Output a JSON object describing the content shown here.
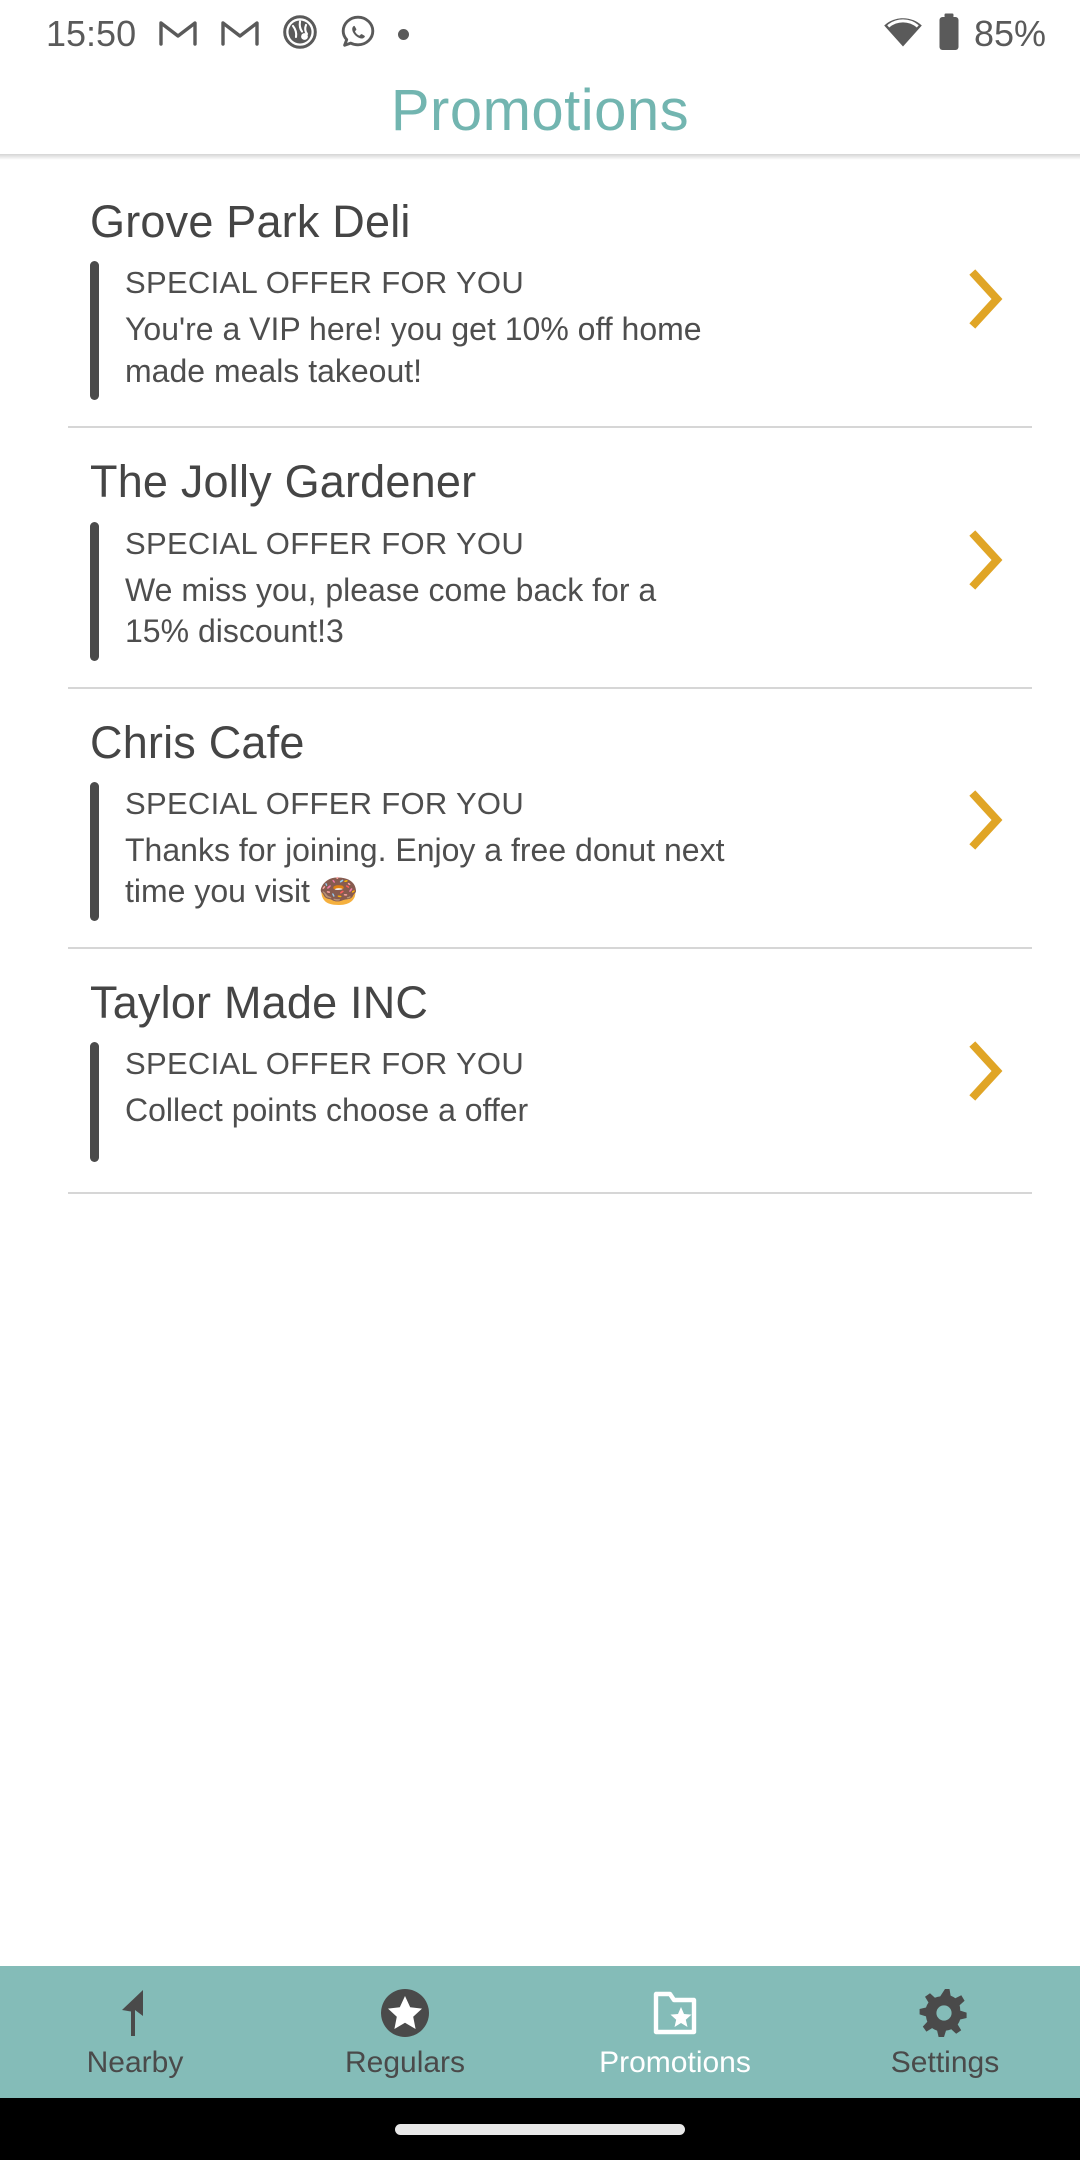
{
  "status_bar": {
    "time": "15:50",
    "battery_percent": "85%",
    "left_icons": [
      "gmail-icon",
      "gmail-icon",
      "browser-globe-icon",
      "whatsapp-icon",
      "dot-indicator-icon"
    ],
    "right_icons": [
      "wifi-icon",
      "battery-icon"
    ]
  },
  "app_bar": {
    "title": "Promotions",
    "title_color": "#72b5b0"
  },
  "colors": {
    "accent_teal": "#72b5b0",
    "nav_background": "#84bcb8",
    "chevron_orange": "#e0a526",
    "text_dark": "#454545",
    "divider": "#d6d6d6"
  },
  "promotions": [
    {
      "merchant": "Grove Park Deli",
      "offer_heading": "SPECIAL OFFER FOR YOU",
      "offer_body": "You're a VIP here! you get 10% off home made meals takeout!",
      "chevron": "chevron-right-icon"
    },
    {
      "merchant": "The Jolly Gardener",
      "offer_heading": "SPECIAL OFFER FOR YOU",
      "offer_body": "We miss you, please come back for a 15% discount!3",
      "chevron": "chevron-right-icon"
    },
    {
      "merchant": "Chris Cafe",
      "offer_heading": "SPECIAL OFFER FOR YOU",
      "offer_body": "Thanks for joining. Enjoy a free donut next time you visit 🍩",
      "chevron": "chevron-right-icon"
    },
    {
      "merchant": "Taylor Made INC",
      "offer_heading": "SPECIAL OFFER FOR YOU",
      "offer_body": "Collect points choose a offer",
      "chevron": "chevron-right-icon"
    }
  ],
  "bottom_nav": {
    "items": [
      {
        "label": "Nearby",
        "icon": "navigation-arrow-icon",
        "active": false
      },
      {
        "label": "Regulars",
        "icon": "star-circle-icon",
        "active": false
      },
      {
        "label": "Promotions",
        "icon": "folder-star-icon",
        "active": true
      },
      {
        "label": "Settings",
        "icon": "gear-icon",
        "active": false
      }
    ]
  }
}
